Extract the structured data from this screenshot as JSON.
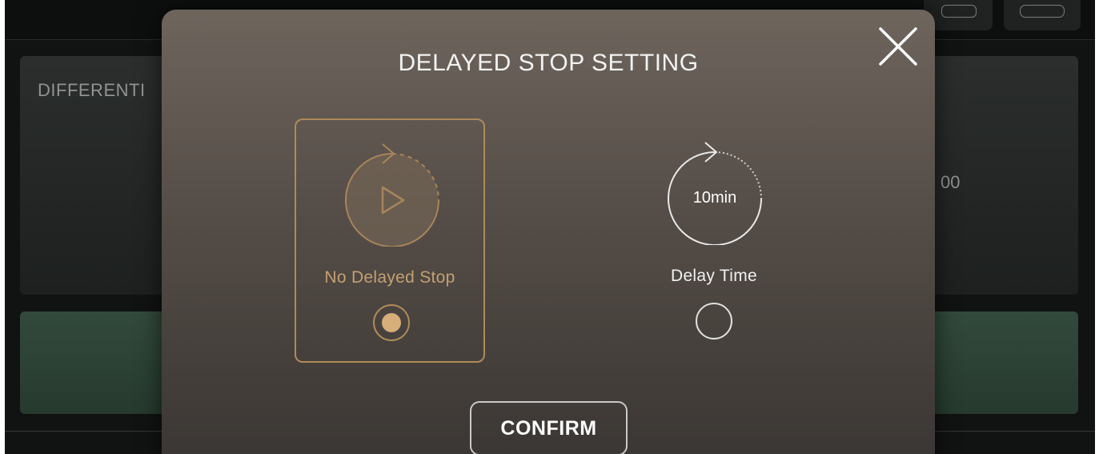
{
  "background": {
    "card_title": "DIFFERENTI",
    "card_value": "00",
    "colors": {
      "app_bg": "#111312",
      "card": "#2b2e2d",
      "green_bar": "#324a3b"
    }
  },
  "dialog": {
    "title": "DELAYED STOP SETTING",
    "close_icon": "close-icon",
    "options": [
      {
        "label": "No Delayed Stop",
        "icon": "play-circle-icon",
        "selected": true
      },
      {
        "label": "Delay Time",
        "icon": "timer-circle-icon",
        "time_text": "10min",
        "selected": false
      }
    ],
    "confirm_label": "CONFIRM",
    "colors": {
      "accent": "#b08a5a",
      "accent_text": "#c4a071",
      "text": "#f0f0f0"
    }
  }
}
